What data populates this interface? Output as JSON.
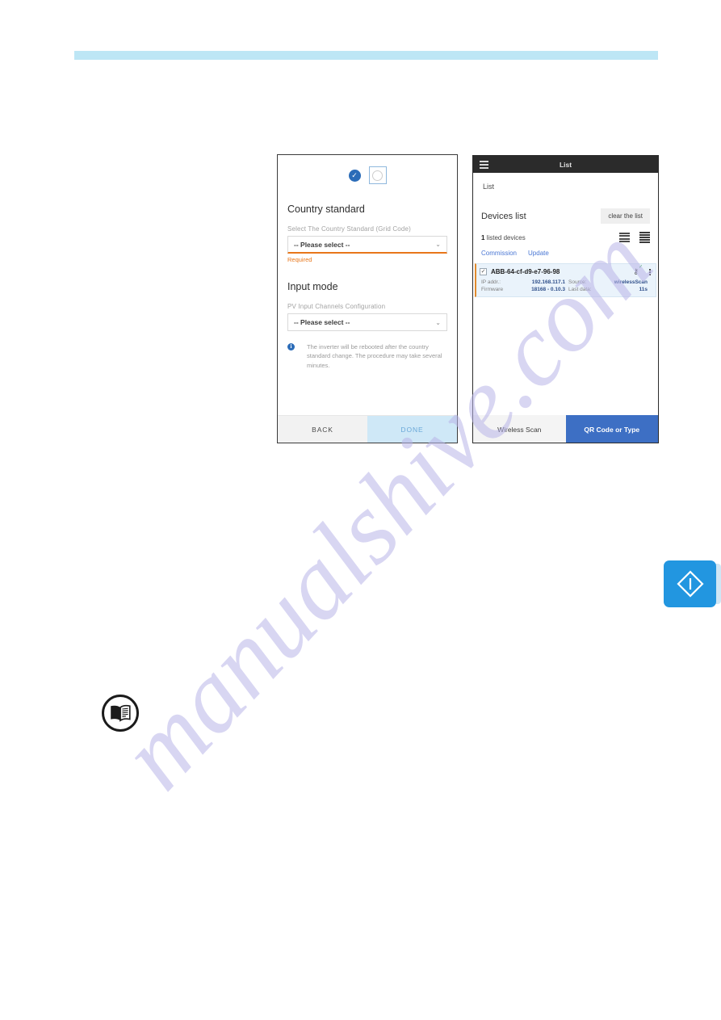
{
  "page": {
    "header_rule_color": "#bde6f5",
    "watermark_text": "manualshive.com"
  },
  "wizard": {
    "steps": [
      {
        "name": "completed-step",
        "state": "done",
        "glyph": "✓"
      },
      {
        "name": "current-step",
        "state": "current",
        "glyph": ""
      }
    ],
    "country_section": {
      "title": "Country standard",
      "field_label": "Select The Country Standard (Grid Code)",
      "select_value": "-- Please select --",
      "chevron": "⌄",
      "validation_message": "Required",
      "validation_color": "#e8761a"
    },
    "input_section": {
      "title": "Input mode",
      "field_label": "PV Input Channels Configuration",
      "select_value": "-- Please select --",
      "chevron": "⌄"
    },
    "info_note": {
      "icon_glyph": "i",
      "text": "The inverter will be rebooted after the country standard change. The procedure may take several minutes."
    },
    "footer": {
      "back_label": "BACK",
      "done_label": "DONE",
      "done_color": "#cfe8f7"
    }
  },
  "phone": {
    "topbar": {
      "menu_icon": "hamburger-icon",
      "title": "List"
    },
    "breadcrumb": "List",
    "devices_header": {
      "title": "Devices list",
      "clear_button": "clear the list"
    },
    "count_row": {
      "count": "1",
      "count_suffix": " listed devices",
      "view_compact_icon": "list-compact-icon",
      "view_detailed_icon": "list-detailed-icon"
    },
    "tabs": [
      {
        "label": "Commission"
      },
      {
        "label": "Update"
      }
    ],
    "device": {
      "checkbox_glyph": "✓",
      "name": "ABB-64-cf-d9-e7-96-98",
      "key_icon": "key-icon",
      "key_status_glyph": "✓",
      "menu_icon": "kebab-menu-icon",
      "fields": [
        {
          "key": "IP addr.:",
          "value": "192.168.117.1"
        },
        {
          "key": "Source:",
          "value": "wirelessScan"
        },
        {
          "key": "Firmware",
          "value": "18168 - 0.10.3"
        },
        {
          "key": "Last data:",
          "value": "11s"
        }
      ],
      "accent_color": "#e08a2e",
      "row_background": "#eaf3fb"
    },
    "footer": {
      "wireless_label": "Wireless Scan",
      "qr_label": "QR Code or Type",
      "qr_color": "#3d6fc4"
    }
  },
  "icons": {
    "manual_icon": "open-book-icon",
    "side_badge_icon": "diamond-exclamation-icon"
  }
}
